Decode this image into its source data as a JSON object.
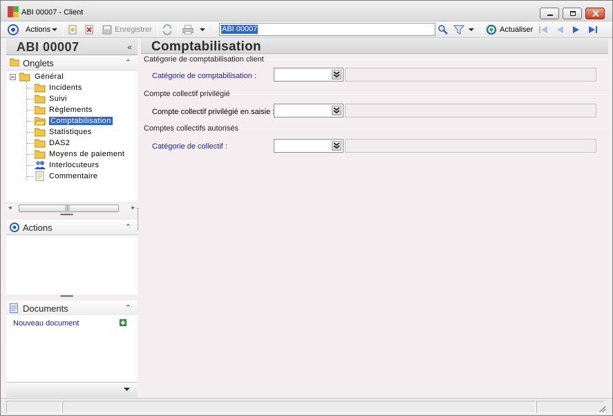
{
  "window": {
    "title": "ABI 00007 -  Client"
  },
  "toolbar": {
    "actions_label": "Actions",
    "save_label": "Enregistrer",
    "search_value": "ABI 00007",
    "refresh_label": "Actualiser"
  },
  "left": {
    "record_title": "ABI 00007",
    "tabs_header": "Onglets",
    "tree": {
      "root": "Général",
      "items": [
        "Incidents",
        "Suivi",
        "Règlements",
        "Comptabilisation",
        "Statistiques",
        "DAS2",
        "Moyens de paiement",
        "Interlocuteurs",
        "Commentaire"
      ],
      "selected": "Comptabilisation"
    },
    "actions_header": "Actions",
    "documents_header": "Documents",
    "new_document_label": "Nouveau document"
  },
  "main": {
    "title": "Comptabilisation",
    "groups": [
      {
        "title": "Catégorie de comptabilisation client",
        "field_label": "Catégorie de comptabilisation :",
        "value": "",
        "description": ""
      },
      {
        "title": "Compte collectif privilégié",
        "field_label": "Compte collectif privilégié en saisie :",
        "value": "",
        "description": ""
      },
      {
        "title": "Comptes collectifs autorisés",
        "field_label": "Catégorie de collectif :",
        "value": "",
        "description": ""
      }
    ]
  },
  "colors": {
    "accent": "#3167c6",
    "label_blue": "#1f1f8f",
    "background": "#f4eef1"
  }
}
